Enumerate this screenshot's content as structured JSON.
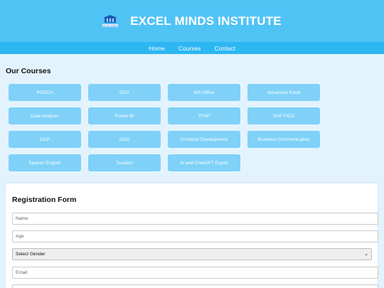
{
  "header": {
    "title": "EXCEL MINDS INSTITUTE",
    "logo_icon": "institute-logo-icon",
    "logo_text": "EXCEL MINDS"
  },
  "nav": {
    "items": [
      "Home",
      "Courses",
      "Contact"
    ]
  },
  "courses_section": {
    "title": "Our Courses",
    "items": [
      "PGDCA",
      "DCA",
      "MS Office",
      "Advanced Excel",
      "Data Analysis",
      "Power BI",
      "TFAP",
      "SAP FICO",
      "DCP",
      "DOA",
      "Frontend Development",
      "Business Communication",
      "Spoken English",
      "Taxation",
      "AI and ChatGPT Expert"
    ]
  },
  "registration_form": {
    "title": "Registration Form",
    "name_placeholder": "Name",
    "age_placeholder": "Age",
    "gender_selected": "Select Gender",
    "email_placeholder": "Email"
  },
  "colors": {
    "header_bg": "#50c3f5",
    "nav_bg": "#2cb6f2",
    "course_bg": "#7fd1f8",
    "page_bg": "#e3f3fd"
  }
}
